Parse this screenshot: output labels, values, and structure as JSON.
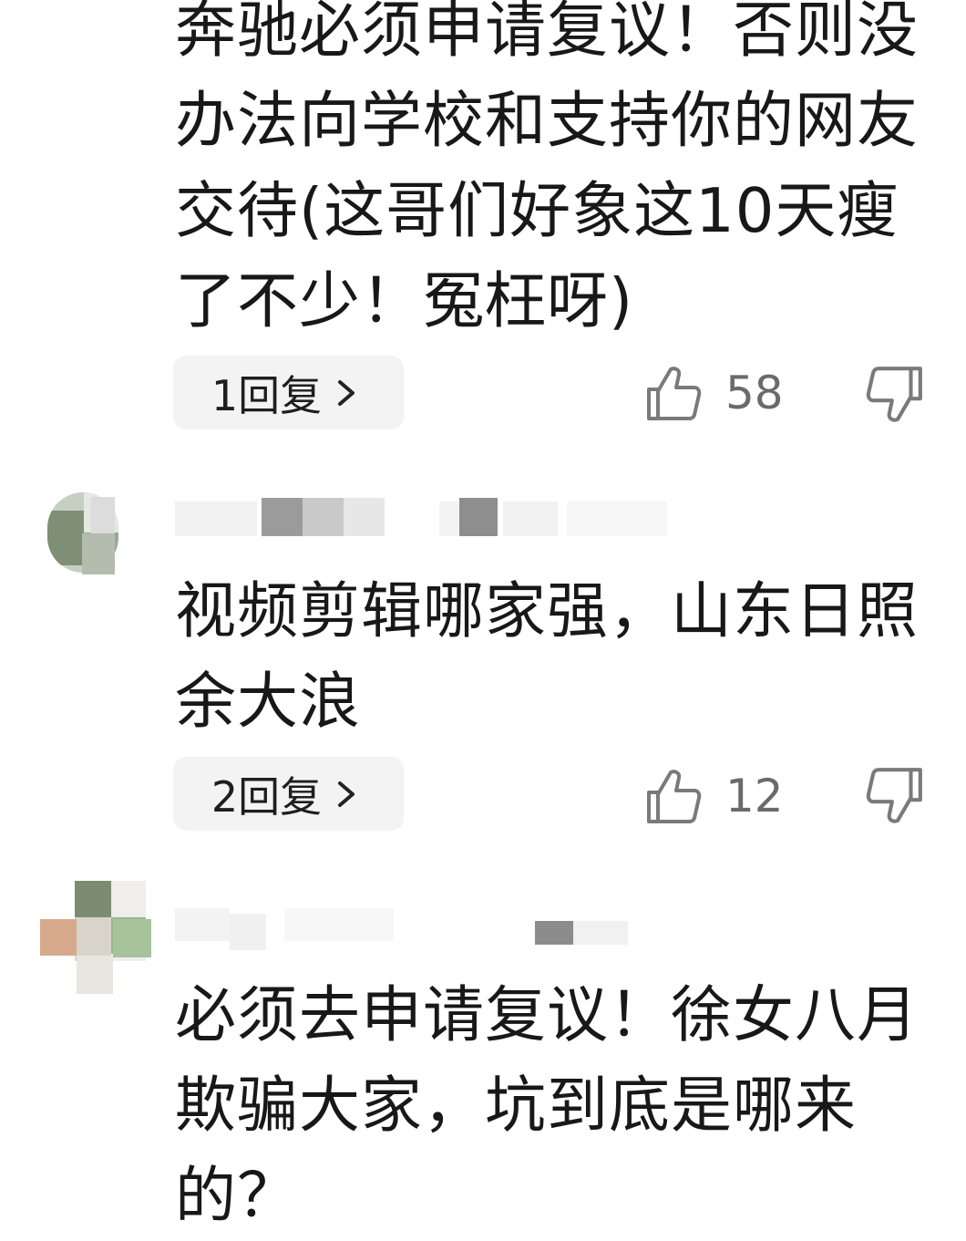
{
  "comments": [
    {
      "text": "奔驰必须申请复议！否则没办法向学校和支持你的网友交待(这哥们好象这10天瘦了不少！冤枉呀)",
      "reply_label": "1回复",
      "likes": "58"
    },
    {
      "text": "视频剪辑哪家强，山东日照余大浪",
      "reply_label": "2回复",
      "likes": "12"
    },
    {
      "text": "必须去申请复议！徐女八月欺骗大家，坑到底是哪来的？"
    }
  ],
  "icons": {
    "like": "thumbs-up-icon",
    "dislike": "thumbs-down-icon",
    "chevron": "chevron-right-icon"
  },
  "colors": {
    "pill_bg": "#f3f3f3",
    "text": "#181818",
    "count": "#6a6a6a"
  }
}
